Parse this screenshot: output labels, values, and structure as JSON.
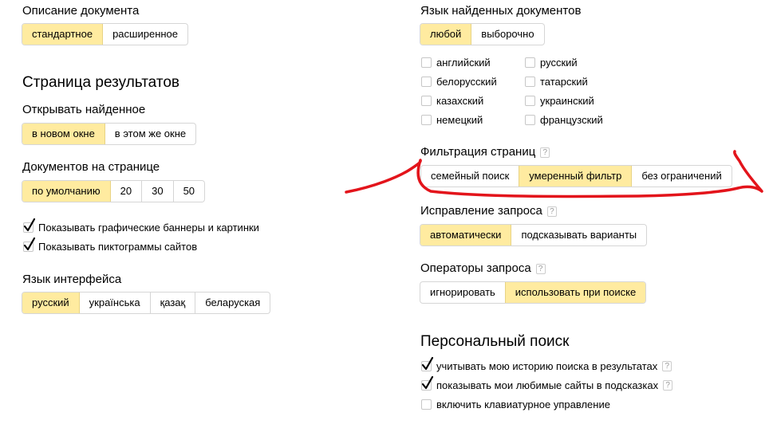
{
  "left": {
    "doc_description": {
      "title": "Описание документа",
      "options": [
        "стандартное",
        "расширенное"
      ],
      "selected": 0
    },
    "results_page": {
      "heading": "Страница результатов",
      "open_found": {
        "title": "Открывать найденное",
        "options": [
          "в новом окне",
          "в этом же окне"
        ],
        "selected": 0
      },
      "docs_per_page": {
        "title": "Документов на странице",
        "options": [
          "по умолчанию",
          "20",
          "30",
          "50"
        ],
        "selected": 0
      },
      "checkboxes": [
        {
          "label": "Показывать графические баннеры и картинки",
          "checked": true
        },
        {
          "label": "Показывать пиктограммы сайтов",
          "checked": true
        }
      ]
    },
    "interface_lang": {
      "title": "Язык интерфейса",
      "options": [
        "русский",
        "українська",
        "қазақ",
        "беларуская"
      ],
      "selected": 0
    }
  },
  "right": {
    "found_docs_lang": {
      "title": "Язык найденных документов",
      "options": [
        "любой",
        "выборочно"
      ],
      "selected": 0,
      "languages": [
        {
          "label": "английский",
          "checked": false
        },
        {
          "label": "русский",
          "checked": false
        },
        {
          "label": "белорусский",
          "checked": false
        },
        {
          "label": "татарский",
          "checked": false
        },
        {
          "label": "казахский",
          "checked": false
        },
        {
          "label": "украинский",
          "checked": false
        },
        {
          "label": "немецкий",
          "checked": false
        },
        {
          "label": "французский",
          "checked": false
        }
      ]
    },
    "page_filter": {
      "title": "Фильтрация страниц",
      "help": "?",
      "options": [
        "семейный поиск",
        "умеренный фильтр",
        "без ограничений"
      ],
      "selected": 1
    },
    "query_correction": {
      "title": "Исправление запроса",
      "help": "?",
      "options": [
        "автоматически",
        "подсказывать варианты"
      ],
      "selected": 0
    },
    "query_operators": {
      "title": "Операторы запроса",
      "help": "?",
      "options": [
        "игнорировать",
        "использовать при поиске"
      ],
      "selected": 1
    },
    "personal_search": {
      "heading": "Персональный поиск",
      "checkboxes": [
        {
          "label": "учитывать мою историю поиска в результатах",
          "checked": true,
          "help": "?"
        },
        {
          "label": "показывать мои любимые сайты в подсказках",
          "checked": true,
          "help": "?"
        },
        {
          "label": "включить клавиатурное управление",
          "checked": false,
          "help": ""
        }
      ]
    }
  },
  "colors": {
    "selected_bg": "#ffeba0",
    "annotation_red": "#e3141b",
    "checkmark": "#000000"
  }
}
